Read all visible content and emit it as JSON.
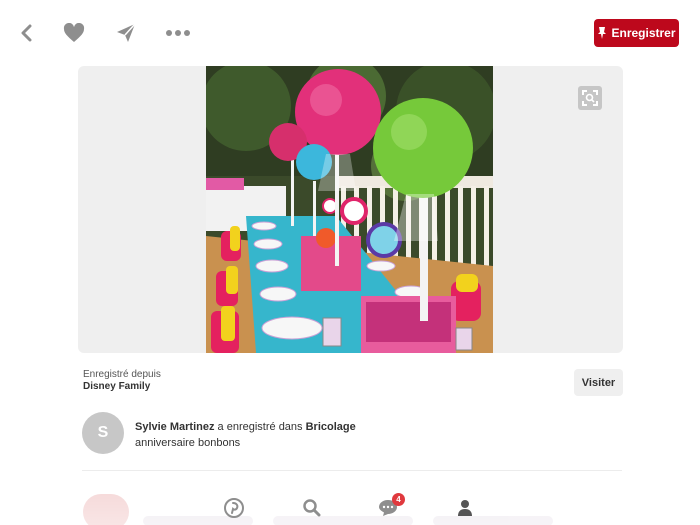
{
  "toolbar": {
    "save_label": "Enregistrer"
  },
  "source": {
    "saved_from_label": "Enregistré depuis",
    "site_name": "Disney Family",
    "visit_label": "Visiter"
  },
  "activity": {
    "avatar_initial": "S",
    "user_name": "Sylvie Martinez",
    "action_text": "a enregistré dans",
    "board_name": "Bricolage",
    "description": "anniversaire bonbons"
  },
  "bottom_nav": {
    "messages_badge": "4",
    "items": [
      "home-icon",
      "search-icon",
      "messages-icon",
      "profile-icon"
    ]
  },
  "colors": {
    "brand_red": "#bd081c",
    "badge_red": "#e0393e"
  }
}
